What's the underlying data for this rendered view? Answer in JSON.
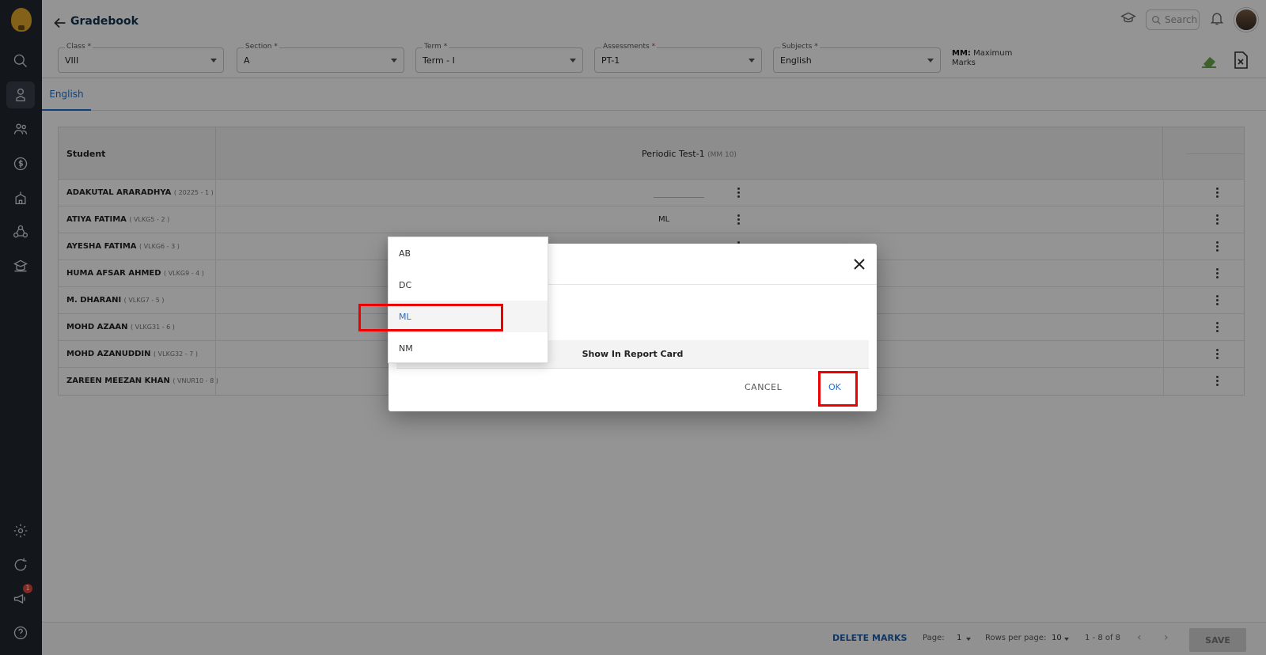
{
  "app": {
    "title": "Gradebook"
  },
  "header": {
    "search_placeholder": "Search"
  },
  "sidebar": {
    "badge_count": "1"
  },
  "filters": [
    {
      "label": "Class",
      "required": "*",
      "value": "VIII"
    },
    {
      "label": "Section",
      "required": "*",
      "value": "A"
    },
    {
      "label": "Term",
      "required": "*",
      "value": "Term - I"
    },
    {
      "label": "Assessments",
      "required": "*",
      "value": "PT-1"
    },
    {
      "label": "Subjects",
      "required": "*",
      "value": "English"
    }
  ],
  "mm_note": {
    "prefix": "MM:",
    "text": "Maximum Marks"
  },
  "tabs": [
    {
      "label": "English",
      "active": true
    }
  ],
  "table": {
    "col_student": "Student",
    "col_assessment": "Periodic Test-1",
    "col_assessment_mm": "(MM 10)",
    "rows": [
      {
        "name": "ADAKUTAL ARARADHYA",
        "id": "( 20225 - 1 )",
        "mark": ""
      },
      {
        "name": "ATIYA FATIMA",
        "id": "( VLKG5 - 2 )",
        "mark": "ML"
      },
      {
        "name": "AYESHA FATIMA",
        "id": "( VLKG6 - 3 )",
        "mark": ""
      },
      {
        "name": "HUMA AFSAR AHMED",
        "id": "( VLKG9 - 4 )",
        "mark": ""
      },
      {
        "name": "M. DHARANI",
        "id": "( VLKG7 - 5 )",
        "mark": ""
      },
      {
        "name": "MOHD AZAAN",
        "id": "( VLKG31 - 6 )",
        "mark": ""
      },
      {
        "name": "MOHD AZANUDDIN",
        "id": "( VLKG32 - 7 )",
        "mark": ""
      },
      {
        "name": "ZAREEN MEEZAN KHAN",
        "id": "( VNUR10 - 8 )",
        "mark": ""
      }
    ]
  },
  "footer": {
    "delete_label": "DELETE MARKS",
    "page_label": "Page:",
    "page_value": "1",
    "rows_label": "Rows per page:",
    "rows_value": "10",
    "range": "1 - 8 of 8",
    "save_label": "SAVE"
  },
  "modal": {
    "show_in_report_card": "Show In Report Card",
    "cancel_label": "CANCEL",
    "ok_label": "OK"
  },
  "dropdown": {
    "options": [
      "AB",
      "DC",
      "ML",
      "NM"
    ],
    "selected": "ML"
  },
  "colors": {
    "accent": "#1e6fd0",
    "highlight": "#ee0000",
    "sidebar": "#22262e"
  }
}
